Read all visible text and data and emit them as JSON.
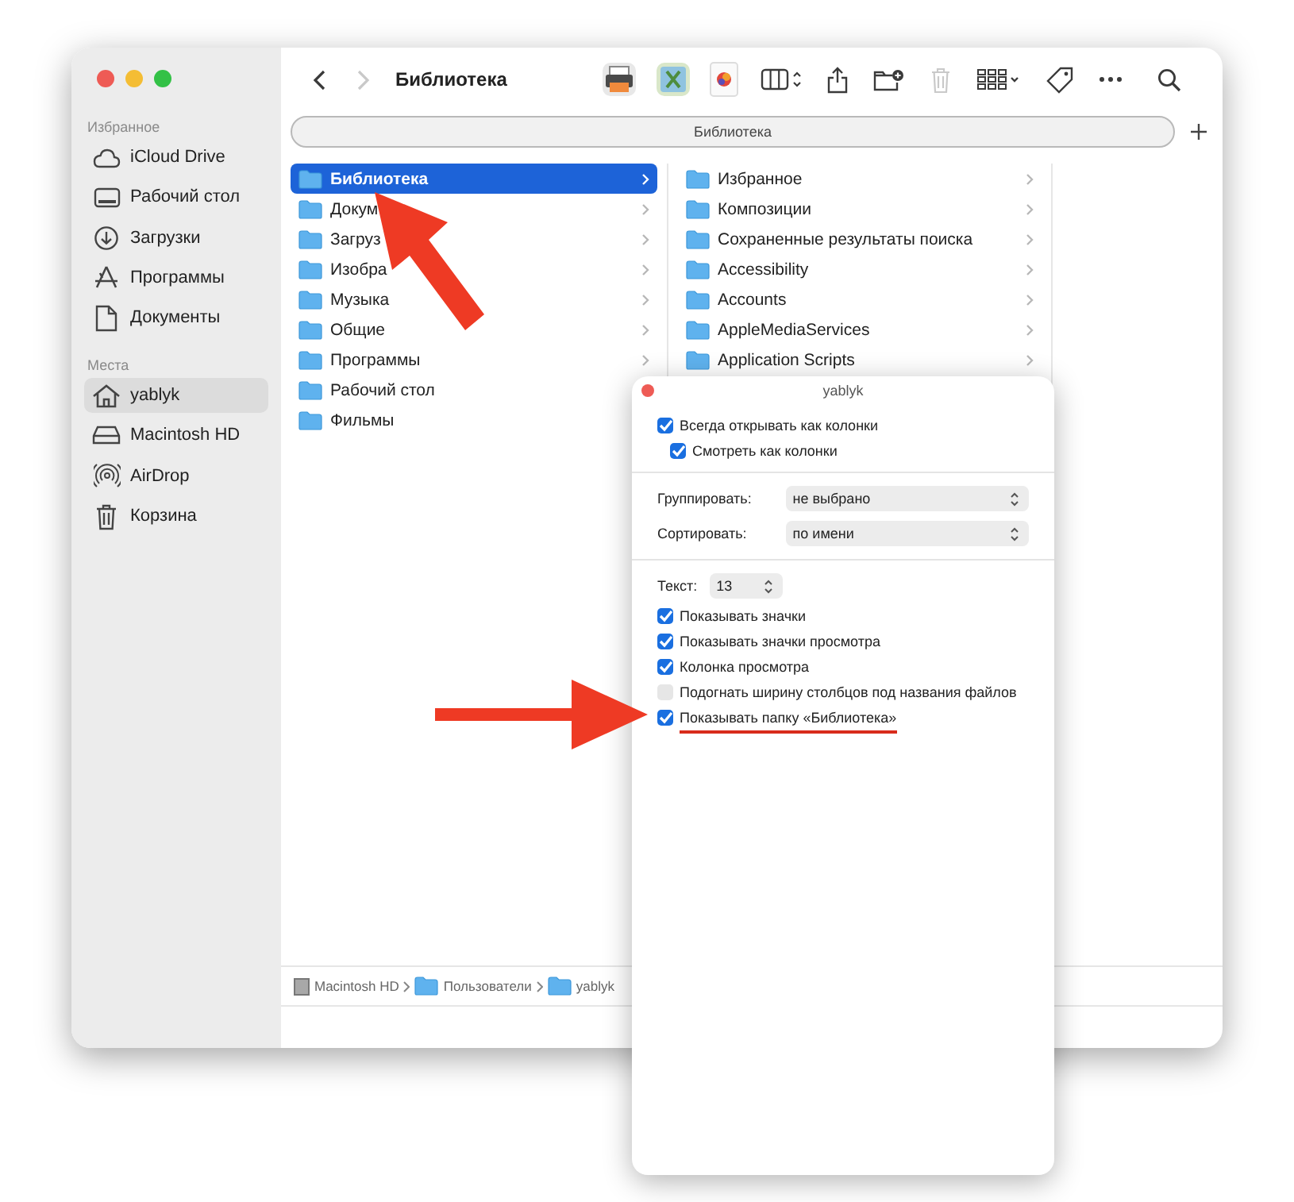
{
  "window": {
    "title": "Библиотека"
  },
  "toolbar": [
    {
      "kind": "back",
      "disabled": false
    },
    {
      "kind": "forward",
      "disabled": true
    },
    {
      "kind": "app-printer",
      "disabled": false
    },
    {
      "kind": "app-script",
      "disabled": false
    },
    {
      "kind": "app-color",
      "disabled": false
    },
    {
      "kind": "view-columns",
      "disabled": false
    },
    {
      "kind": "share",
      "disabled": false
    },
    {
      "kind": "new-folder",
      "disabled": false
    },
    {
      "kind": "trash",
      "disabled": true
    },
    {
      "kind": "group",
      "disabled": false
    },
    {
      "kind": "tag",
      "disabled": false
    },
    {
      "kind": "more",
      "disabled": false
    },
    {
      "kind": "search",
      "disabled": false
    }
  ],
  "tab_bar": {
    "tab": "Библиотека"
  },
  "sidebar": [
    {
      "heading": "Избранное",
      "items": [
        {
          "label": "iCloud Drive",
          "kind": "cloud",
          "selected": false
        },
        {
          "label": "Рабочий стол",
          "kind": "desktop",
          "selected": false
        },
        {
          "label": "Загрузки",
          "kind": "download",
          "selected": false
        },
        {
          "label": "Программы",
          "kind": "apps",
          "selected": false
        },
        {
          "label": "Документы",
          "kind": "document",
          "selected": false
        }
      ]
    },
    {
      "heading": "Места",
      "items": [
        {
          "label": "yablyk",
          "kind": "home",
          "selected": true
        },
        {
          "label": "Macintosh HD",
          "kind": "disk",
          "selected": false
        },
        {
          "label": "AirDrop",
          "kind": "airdrop",
          "selected": false
        },
        {
          "label": "Корзина",
          "kind": "trash",
          "selected": false
        }
      ]
    }
  ],
  "columns": [
    [
      {
        "label": "Библиотека",
        "selected": true
      },
      {
        "label": "Докум",
        "selected": false
      },
      {
        "label": "Загруз",
        "selected": false
      },
      {
        "label": "Изобра",
        "selected": false
      },
      {
        "label": "Музыка",
        "selected": false
      },
      {
        "label": "Общие",
        "selected": false
      },
      {
        "label": "Программы",
        "selected": false
      },
      {
        "label": "Рабочий стол",
        "selected": false
      },
      {
        "label": "Фильмы",
        "selected": false
      }
    ],
    [
      {
        "label": "Избранное",
        "selected": false
      },
      {
        "label": "Композиции",
        "selected": false
      },
      {
        "label": "Сохраненные результаты поиска",
        "selected": false
      },
      {
        "label": "Accessibility",
        "selected": false
      },
      {
        "label": "Accounts",
        "selected": false
      },
      {
        "label": "AppleMediaServices",
        "selected": false
      },
      {
        "label": "Application Scripts",
        "selected": false
      }
    ]
  ],
  "path_bar": [
    {
      "label": "Macintosh HD",
      "kind": "disk"
    },
    {
      "label": "Пользователи",
      "kind": "folder"
    },
    {
      "label": "yablyk",
      "kind": "folder"
    }
  ],
  "view_options": {
    "title": "yablyk",
    "sections": [
      [
        {
          "kind": "checkbox",
          "label": "Всегда открывать как колонки",
          "checked": true,
          "underlined": false,
          "children": [
            {
              "label": "Смотреть как колонки",
              "checked": true,
              "underlined": false
            }
          ]
        }
      ],
      [
        {
          "kind": "select",
          "label": "Группировать:",
          "value": "не выбрано"
        },
        {
          "kind": "select",
          "label": "Сортировать:",
          "value": "по имени"
        }
      ],
      [
        {
          "kind": "stepper",
          "label": "Текст:",
          "value": "13"
        },
        {
          "kind": "checkbox",
          "label": "Показывать значки",
          "checked": true,
          "underlined": false
        },
        {
          "kind": "checkbox",
          "label": "Показывать значки просмотра",
          "checked": true,
          "underlined": false
        },
        {
          "kind": "checkbox",
          "label": "Колонка просмотра",
          "checked": true,
          "underlined": false
        },
        {
          "kind": "checkbox",
          "label": "Подогнать ширину столбцов под названия файлов",
          "checked": false,
          "underlined": false
        },
        {
          "kind": "checkbox",
          "label": "Показывать папку «Библиотека»",
          "checked": true,
          "underlined": true
        }
      ]
    ]
  }
}
